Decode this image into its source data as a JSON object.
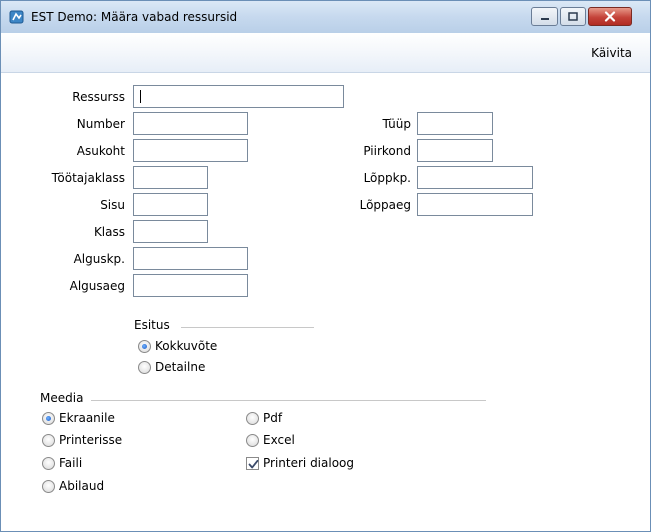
{
  "window": {
    "title": "EST Demo: Määra vabad ressursid"
  },
  "menu": {
    "run_label": "Käivita"
  },
  "form": {
    "ressurss": {
      "label": "Ressurss",
      "value": ""
    },
    "number": {
      "label": "Number",
      "value": ""
    },
    "asukoht": {
      "label": "Asukoht",
      "value": ""
    },
    "tootajaklass": {
      "label": "Töötajaklass",
      "value": ""
    },
    "sisu": {
      "label": "Sisu",
      "value": ""
    },
    "klass": {
      "label": "Klass",
      "value": ""
    },
    "alguskp": {
      "label": "Alguskp.",
      "value": ""
    },
    "algusaeg": {
      "label": "Algusaeg",
      "value": ""
    },
    "tuup": {
      "label": "Tüüp",
      "value": ""
    },
    "piirkond": {
      "label": "Piirkond",
      "value": ""
    },
    "loppkp": {
      "label": "Lõppkp.",
      "value": ""
    },
    "loppaeg": {
      "label": "Lõppaeg",
      "value": ""
    }
  },
  "esitus": {
    "title": "Esitus",
    "options": [
      {
        "label": "Kokkuvõte",
        "checked": true
      },
      {
        "label": "Detailne",
        "checked": false
      }
    ]
  },
  "meedia": {
    "title": "Meedia",
    "options": [
      {
        "label": "Ekraanile",
        "checked": true
      },
      {
        "label": "Printerisse",
        "checked": false
      },
      {
        "label": "Faili",
        "checked": false
      },
      {
        "label": "Abilaud",
        "checked": false
      },
      {
        "label": "Pdf",
        "checked": false
      },
      {
        "label": "Excel",
        "checked": false
      }
    ],
    "printer_dialog": {
      "label": "Printeri dialoog",
      "checked": true
    }
  },
  "colors": {
    "accent_radio": "#1b58c2",
    "close_button": "#c4433a"
  }
}
